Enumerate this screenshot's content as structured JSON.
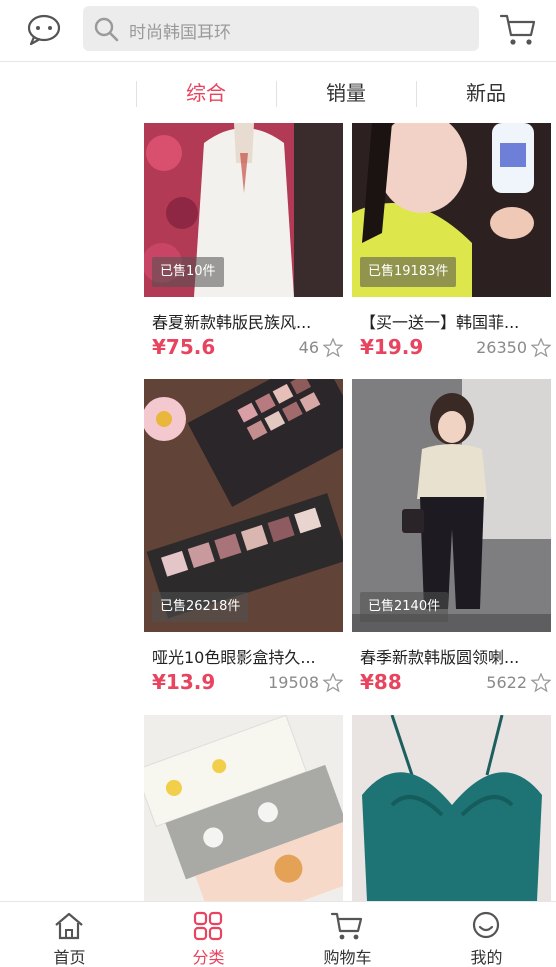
{
  "header": {
    "search_placeholder": "时尚韩国耳环",
    "chat_icon": "chat-bubble-icon",
    "cart_icon": "cart-icon"
  },
  "sort_tabs": [
    {
      "label": "综合",
      "active": true
    },
    {
      "label": "销量",
      "active": false
    },
    {
      "label": "新品",
      "active": false
    }
  ],
  "products": [
    {
      "badge": "已售10件",
      "title": "春夏新款韩版民族风...",
      "price": "¥75.6",
      "sales": "46"
    },
    {
      "badge": "已售19183件",
      "title": "【买一送一】韩国菲...",
      "price": "¥19.9",
      "sales": "26350"
    },
    {
      "badge": "已售26218件",
      "title": "哑光10色眼影盒持久...",
      "price": "¥13.9",
      "sales": "19508"
    },
    {
      "badge": "已售2140件",
      "title": "春季新款韩版圆领喇...",
      "price": "¥88",
      "sales": "5622"
    }
  ],
  "bottom_nav": [
    {
      "label": "首页",
      "icon": "home-icon",
      "active": false
    },
    {
      "label": "分类",
      "icon": "category-grid-icon",
      "active": true
    },
    {
      "label": "购物车",
      "icon": "cart-icon",
      "active": false
    },
    {
      "label": "我的",
      "icon": "profile-icon",
      "active": false
    }
  ],
  "colors": {
    "accent": "#e8445f",
    "search_bg": "#ececec"
  }
}
